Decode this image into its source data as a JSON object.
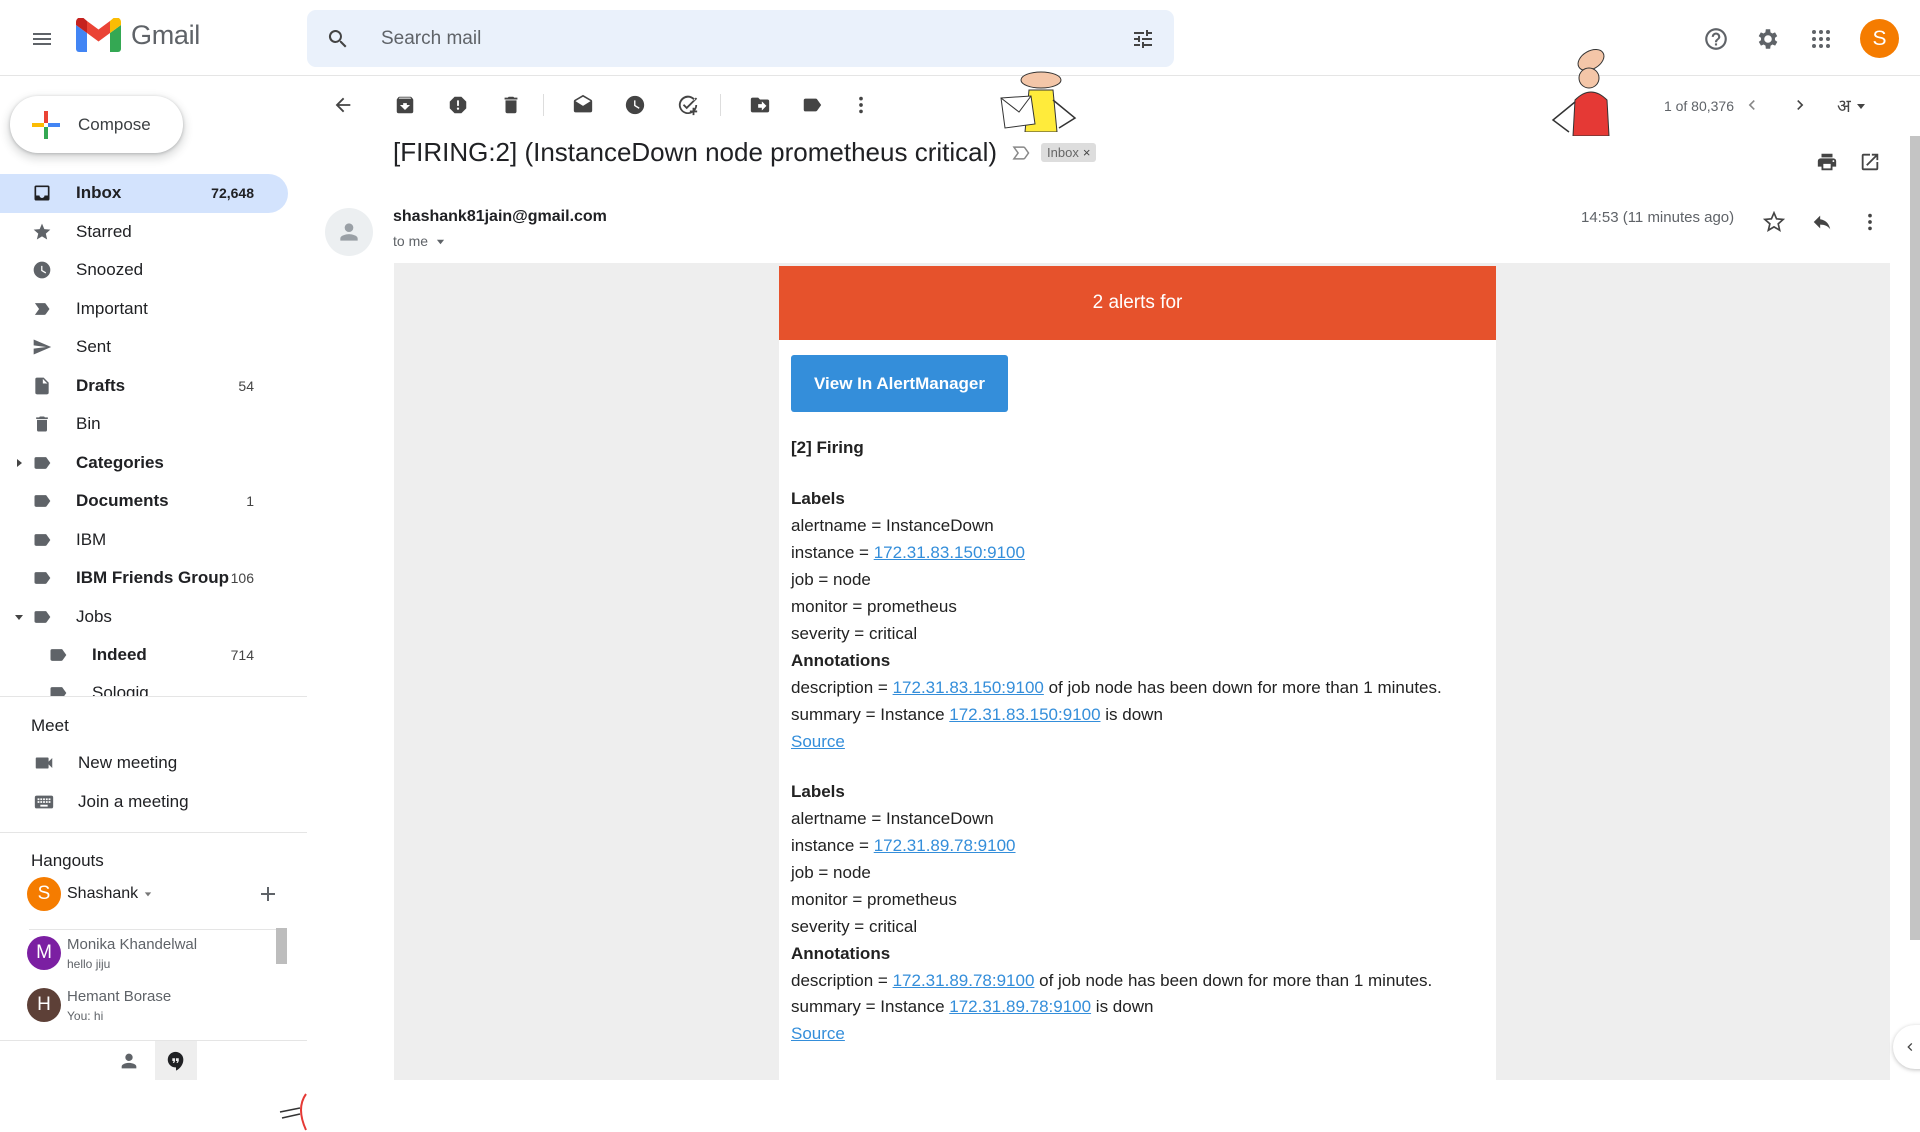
{
  "app": {
    "name": "Gmail",
    "avatar_letter": "S",
    "accent": "#f57c00"
  },
  "search": {
    "placeholder": "Search mail"
  },
  "compose": {
    "label": "Compose"
  },
  "nav": [
    {
      "label": "Inbox",
      "count": "72,648",
      "icon": "inbox-icon",
      "active": true
    },
    {
      "label": "Starred",
      "count": "",
      "icon": "star-icon"
    },
    {
      "label": "Snoozed",
      "count": "",
      "icon": "clock-icon"
    },
    {
      "label": "Important",
      "count": "",
      "icon": "important-icon"
    },
    {
      "label": "Sent",
      "count": "",
      "icon": "send-icon"
    },
    {
      "label": "Drafts",
      "count": "54",
      "icon": "draft-icon",
      "bold": true
    },
    {
      "label": "Bin",
      "count": "",
      "icon": "trash-icon"
    },
    {
      "label": "Categories",
      "count": "",
      "icon": "label-icon",
      "bold": true,
      "caret": "right"
    },
    {
      "label": "Documents",
      "count": "1",
      "icon": "label-icon",
      "bold": true
    },
    {
      "label": "IBM",
      "count": "",
      "icon": "label-icon"
    },
    {
      "label": "IBM Friends Group",
      "count": "106",
      "icon": "label-icon",
      "bold": true
    },
    {
      "label": "Jobs",
      "count": "",
      "icon": "label-icon",
      "caret": "down"
    },
    {
      "label": "Indeed",
      "count": "714",
      "icon": "label-icon",
      "bold": true,
      "indent": true
    },
    {
      "label": "Sologig",
      "count": "",
      "icon": "label-icon",
      "indent": true
    }
  ],
  "meet": {
    "title": "Meet",
    "items": [
      {
        "label": "New meeting",
        "icon": "video-icon"
      },
      {
        "label": "Join a meeting",
        "icon": "keyboard-icon"
      }
    ]
  },
  "hangouts": {
    "title": "Hangouts",
    "self": {
      "name": "Shashank",
      "letter": "S",
      "color": "#f57c00"
    },
    "contacts": [
      {
        "name": "Monika Khandelwal",
        "message": "hello jiju",
        "letter": "M",
        "color": "#7b1fa2"
      },
      {
        "name": "Hemant Borase",
        "message": "You: hi",
        "letter": "H",
        "color": "#5d4037"
      }
    ]
  },
  "pager": {
    "text": "1 of 80,376",
    "lang": "अ"
  },
  "email": {
    "subject": "[FIRING:2] (InstanceDown node prometheus critical)",
    "chip": "Inbox",
    "sender": "shashank81jain@gmail.com",
    "to": "to me",
    "time": "14:53 (11 minutes ago)",
    "body": {
      "header": "2 alerts for",
      "header_color": "#e6522c",
      "button": "View In AlertManager",
      "button_color": "#348eda",
      "firing": "[2] Firing",
      "labels_title": "Labels",
      "annotations_title": "Annotations",
      "source": "Source",
      "alerts": [
        {
          "alertname": "alertname = InstanceDown",
          "instance_prefix": "instance = ",
          "instance": "172.31.83.150:9100",
          "job": "job = node",
          "monitor": "monitor = prometheus",
          "severity": "severity = critical",
          "desc_prefix": "description = ",
          "desc_suffix": " of job node has been down for more than 1 minutes.",
          "sum_prefix": "summary = Instance ",
          "sum_suffix": " is down"
        },
        {
          "alertname": "alertname = InstanceDown",
          "instance_prefix": "instance = ",
          "instance": "172.31.89.78:9100",
          "job": "job = node",
          "monitor": "monitor = prometheus",
          "severity": "severity = critical",
          "desc_prefix": "description = ",
          "desc_suffix": " of job node has been down for more than 1 minutes.",
          "sum_prefix": "summary = Instance ",
          "sum_suffix": " is down"
        }
      ]
    }
  }
}
